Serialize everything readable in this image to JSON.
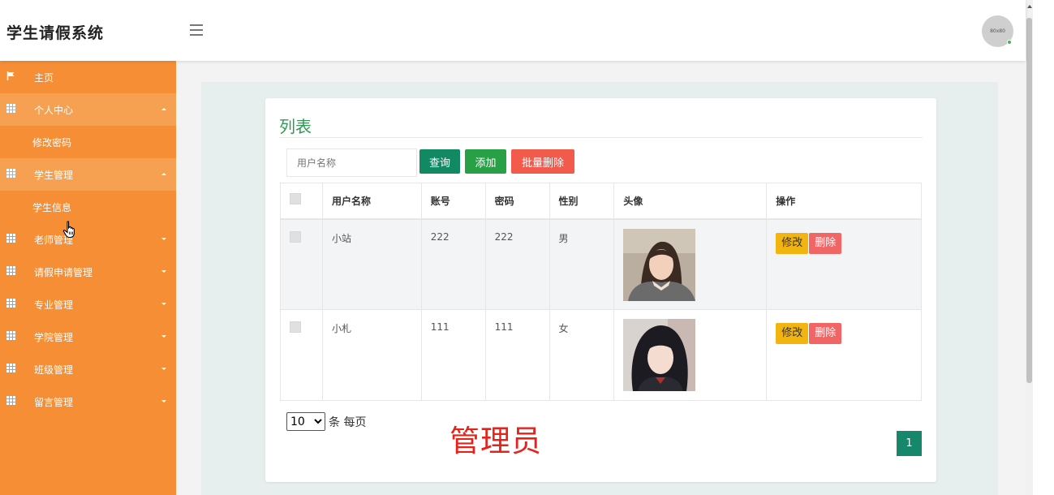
{
  "header": {
    "title": "学生请假系统",
    "avatar_text": "80x80"
  },
  "sidebar": {
    "items": [
      {
        "label": "主页",
        "icon": "flag-icon"
      },
      {
        "label": "个人中心",
        "icon": "grid-icon",
        "expanded": true,
        "children": [
          {
            "label": "修改密码"
          }
        ]
      },
      {
        "label": "学生管理",
        "icon": "grid-icon",
        "expanded": true,
        "children": [
          {
            "label": "学生信息"
          }
        ]
      },
      {
        "label": "老师管理",
        "icon": "grid-icon"
      },
      {
        "label": "请假申请管理",
        "icon": "grid-icon"
      },
      {
        "label": "专业管理",
        "icon": "grid-icon"
      },
      {
        "label": "学院管理",
        "icon": "grid-icon"
      },
      {
        "label": "班级管理",
        "icon": "grid-icon"
      },
      {
        "label": "留言管理",
        "icon": "grid-icon"
      }
    ]
  },
  "main": {
    "title": "列表",
    "search": {
      "placeholder": "用户名称",
      "value": ""
    },
    "buttons": {
      "query": "查询",
      "add": "添加",
      "batch_delete": "批量删除"
    },
    "table": {
      "columns": [
        "用户名称",
        "账号",
        "密码",
        "性别",
        "头像",
        "操作"
      ],
      "rows": [
        {
          "name": "小站",
          "account": "222",
          "password": "222",
          "gender": "男",
          "edit": "修改",
          "delete": "删除"
        },
        {
          "name": "小札",
          "account": "111",
          "password": "111",
          "gender": "女",
          "edit": "修改",
          "delete": "删除"
        }
      ]
    },
    "pagination": {
      "page_size": "10",
      "page_size_options": [
        "10"
      ],
      "page_size_label": "条 每页",
      "current_page": "1"
    },
    "watermark": "管理员"
  },
  "colors": {
    "sidebar": "#f58e35",
    "sidebar_open": "#f6a151",
    "title_green": "#2e9a55",
    "query": "#118a63",
    "add": "#27a046",
    "batch_delete": "#f25a4b",
    "edit": "#f2b510",
    "delete": "#f26565",
    "watermark": "#e6231a",
    "page": "#16876a"
  }
}
